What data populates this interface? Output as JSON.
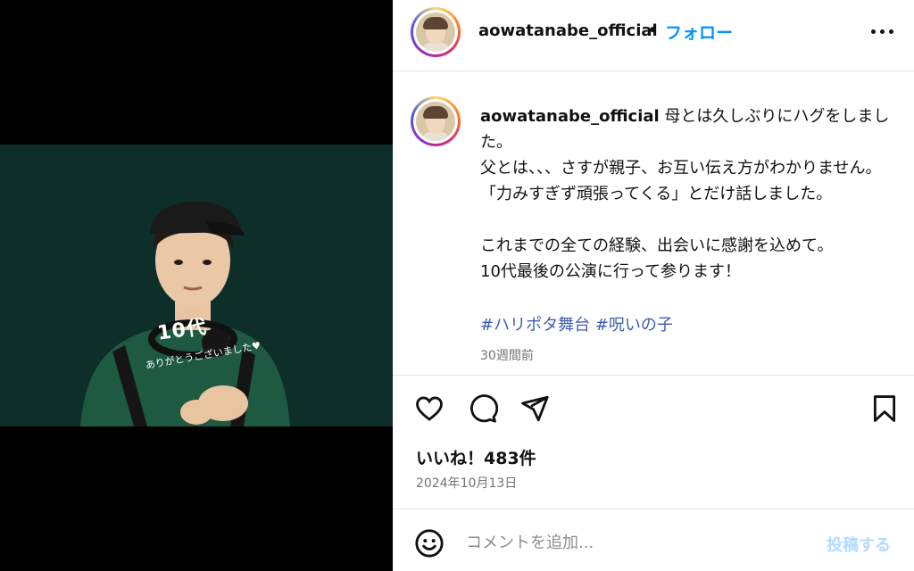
{
  "post": {
    "username": "aowatanabe_official",
    "separator": "•",
    "follow_label": "フォロー",
    "more_icon": "more-horizontal-icon",
    "image_overlay_big": "10代",
    "image_overlay_small": "ありがとうございました♥"
  },
  "caption": {
    "username": "aowatanabe_official",
    "text": " 母とは久しぶりにハグをしました。\n父とは、、、さすが親子、お互い伝え方がわかりません。「力みすぎず頑張ってくる」とだけ話しました。\n\nこれまでの全ての経験、出会いに感謝を込めて。\n10代最後の公演に行って参ります！",
    "hashtags": [
      "#ハリポタ舞台",
      "#呪いの子"
    ],
    "time_ago": "30週間前"
  },
  "actions": {
    "like_icon": "heart-icon",
    "comment_icon": "comment-icon",
    "share_icon": "send-icon",
    "save_icon": "bookmark-icon"
  },
  "stats": {
    "likes": "いいね！483件",
    "date": "2024年10月13日"
  },
  "comment": {
    "placeholder": "コメントを追加...",
    "post_label": "投稿する",
    "emoji_icon": "emoji-icon"
  },
  "colors": {
    "accent": "#0095f6",
    "hashtag": "#3e5cb0",
    "muted": "#737373",
    "post_disabled": "#b3dbff",
    "photo_bg": "#0e2e29"
  }
}
